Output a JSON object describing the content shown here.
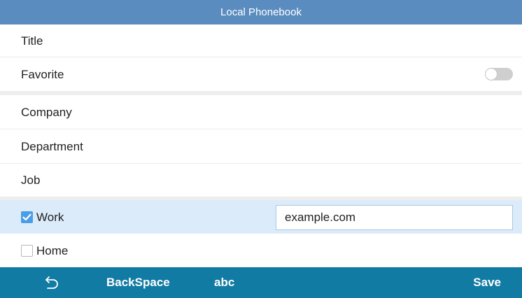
{
  "header": {
    "title": "Local Phonebook"
  },
  "fields": {
    "title_label": "Title",
    "favorite_label": "Favorite",
    "favorite_on": false,
    "company_label": "Company",
    "department_label": "Department",
    "job_label": "Job"
  },
  "email": {
    "work_label": "Work",
    "work_checked": true,
    "work_value": "example.com",
    "home_label": "Home",
    "home_checked": false
  },
  "toolbar": {
    "back_icon": "back-arrow-icon",
    "backspace_label": "BackSpace",
    "abc_label": "abc",
    "save_label": "Save"
  },
  "colors": {
    "titlebar": "#5b8cc0",
    "toolbar": "#127ba3",
    "selected_row": "#dcebfa",
    "checkbox_checked": "#4a9de6"
  }
}
